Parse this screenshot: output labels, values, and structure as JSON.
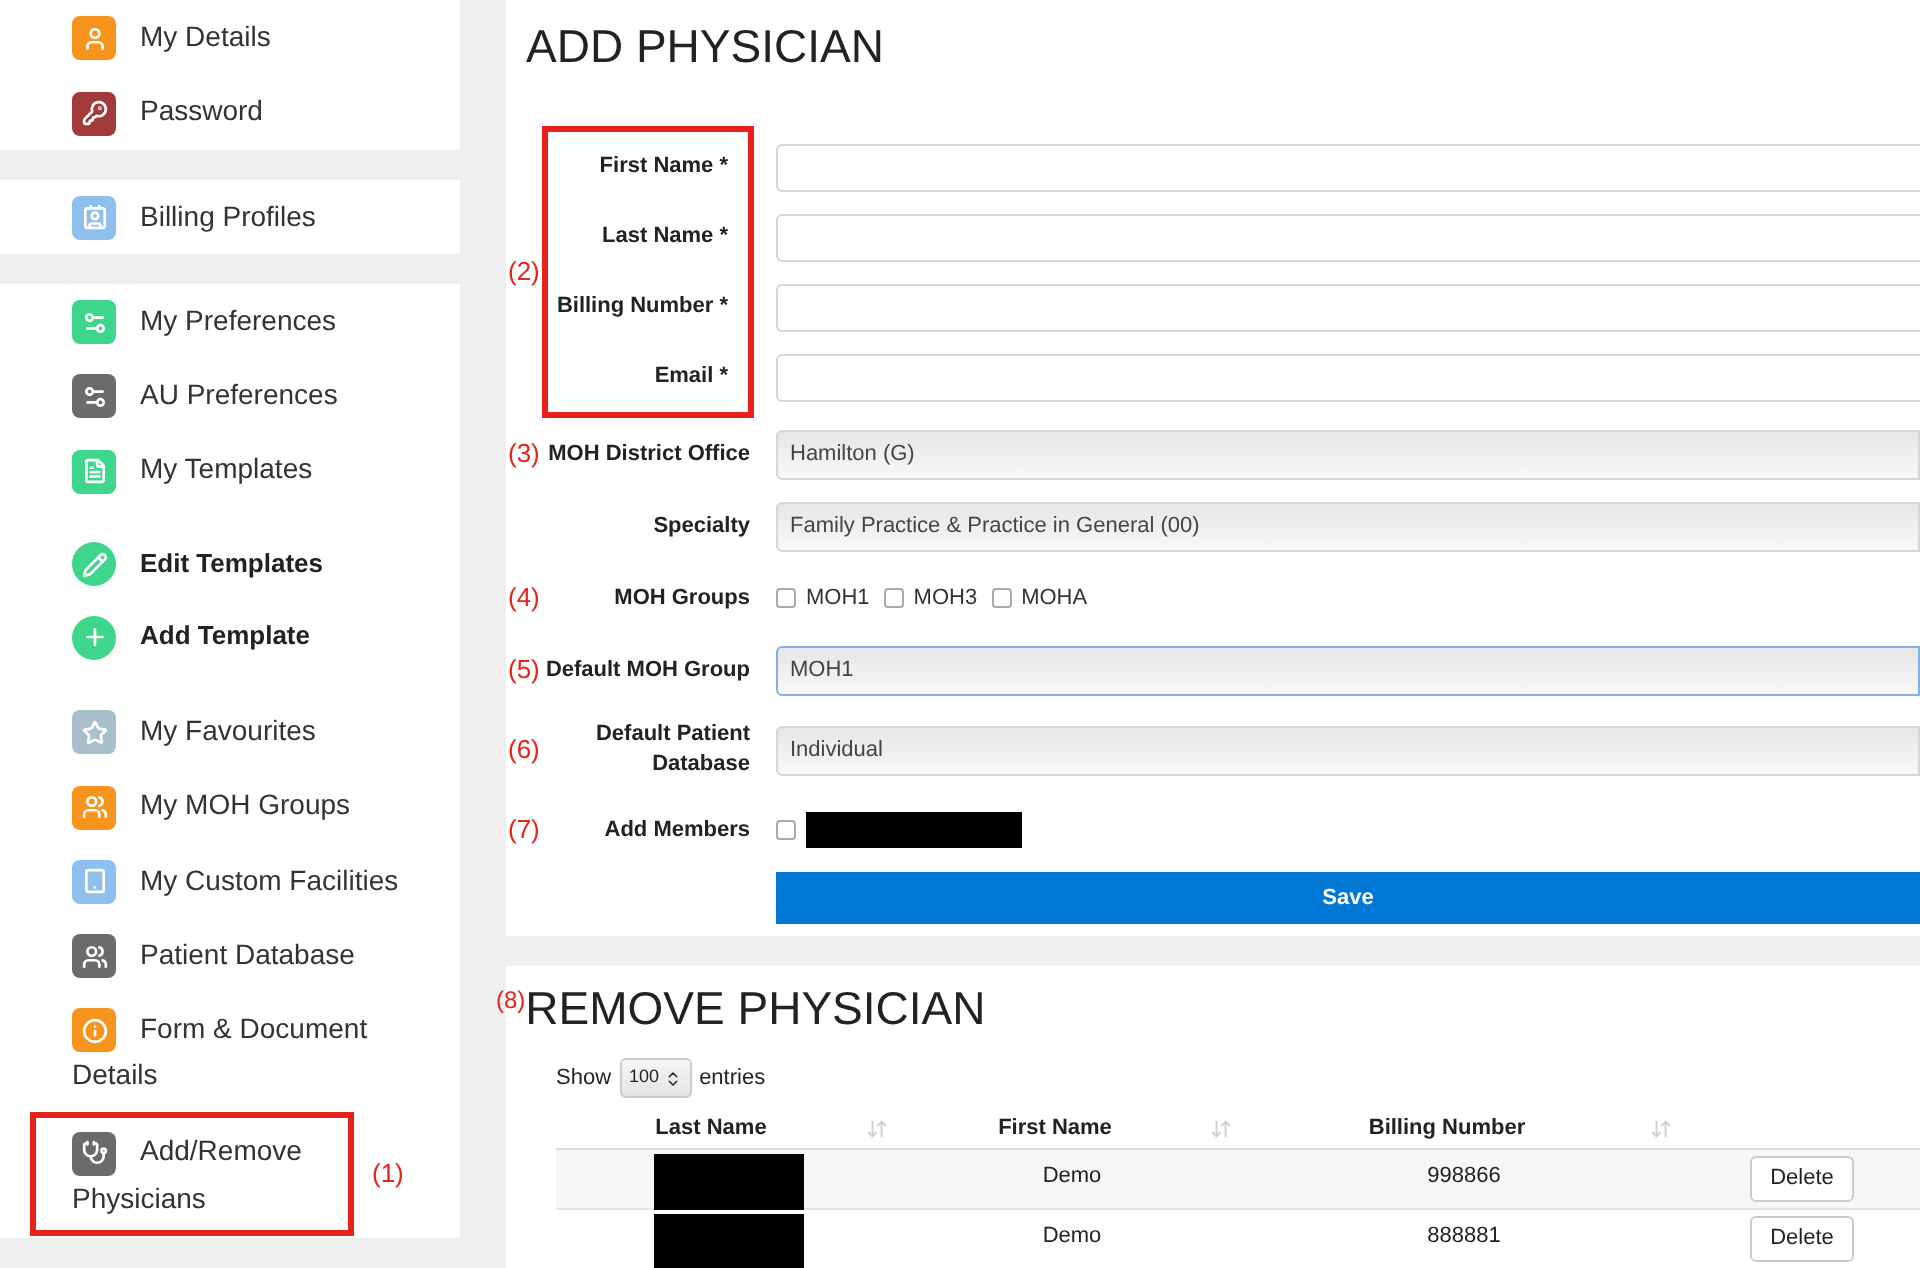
{
  "sidebar": {
    "groups": [
      {
        "items": [
          {
            "kind": "link",
            "label": "My Details",
            "color": "#f7941d",
            "highlighted": false
          },
          {
            "kind": "link",
            "label": "Password",
            "color": "#a33a3a",
            "highlighted": false
          }
        ]
      },
      {
        "items": [
          {
            "kind": "link",
            "label": "Billing Profiles",
            "color": "#8fbfef",
            "highlighted": false
          }
        ]
      },
      {
        "items": [
          {
            "kind": "link",
            "label": "My Preferences",
            "color": "#3dd68c",
            "highlighted": false
          },
          {
            "kind": "link",
            "label": "AU Preferences",
            "color": "#6b6b6b",
            "highlighted": false
          },
          {
            "kind": "link",
            "label": "My Templates",
            "color": "#3dd68c",
            "highlighted": false
          },
          {
            "kind": "action",
            "label": "Edit Templates",
            "color": "#3dd68c",
            "highlighted": false
          },
          {
            "kind": "action",
            "label": "Add Template",
            "color": "#3dd68c",
            "highlighted": false
          },
          {
            "kind": "link",
            "label": "My Favourites",
            "color": "#aabfcc",
            "highlighted": false
          },
          {
            "kind": "link",
            "label": "My MOH Groups",
            "color": "#f7941d",
            "highlighted": false
          },
          {
            "kind": "link",
            "label": "My Custom Facilities",
            "color": "#8fbfef",
            "highlighted": false
          },
          {
            "kind": "link",
            "label": "Patient Database",
            "color": "#6b6b6b",
            "highlighted": false
          },
          {
            "kind": "link",
            "label": "Form & Document Details",
            "color": "#f7941d",
            "highlighted": false
          },
          {
            "kind": "link",
            "label": "Add/Remove Physicians",
            "color": "#6b6b6b",
            "highlighted": true,
            "marker": "(1)"
          }
        ]
      }
    ]
  },
  "add_physician": {
    "title": "ADD PHYSICIAN",
    "required_group": {
      "marker": "(2)",
      "fields": [
        {
          "label": "First Name *"
        },
        {
          "label": "Last Name *"
        },
        {
          "label": "Billing Number *"
        },
        {
          "label": "Email *"
        }
      ]
    },
    "fields": [
      {
        "kind": "select",
        "marker": "(3)",
        "label": "MOH District Office",
        "value": "Hamilton (G)",
        "focused": false
      },
      {
        "kind": "select",
        "label": "Specialty",
        "value": "Family Practice & Practice in General (00)",
        "focused": false
      },
      {
        "kind": "checkboxes",
        "marker": "(4)",
        "label": "MOH Groups",
        "options": [
          {
            "label": "MOH1",
            "checked": false
          },
          {
            "label": "MOH3",
            "checked": false
          },
          {
            "label": "MOHA",
            "checked": false
          }
        ]
      },
      {
        "kind": "select",
        "marker": "(5)",
        "label": "Default MOH Group",
        "value": "MOH1",
        "focused": true
      },
      {
        "kind": "select",
        "marker": "(6)",
        "label": "Default Patient Database",
        "value": "Individual",
        "focused": false
      },
      {
        "kind": "members",
        "marker": "(7)",
        "label": "Add Members",
        "checked": false
      }
    ],
    "save_button": "Save"
  },
  "remove_physician": {
    "marker": "(8)",
    "title": "REMOVE PHYSICIAN",
    "show_label": "Show",
    "page_size": "100",
    "entries_label": "entries",
    "table": {
      "columns": [
        "Last Name",
        "First Name",
        "Billing Number"
      ],
      "rows": [
        {
          "first_name": "Demo",
          "billing_number": "998866",
          "action": "Delete"
        },
        {
          "first_name": "Demo",
          "billing_number": "888881",
          "action": "Delete"
        }
      ]
    }
  }
}
